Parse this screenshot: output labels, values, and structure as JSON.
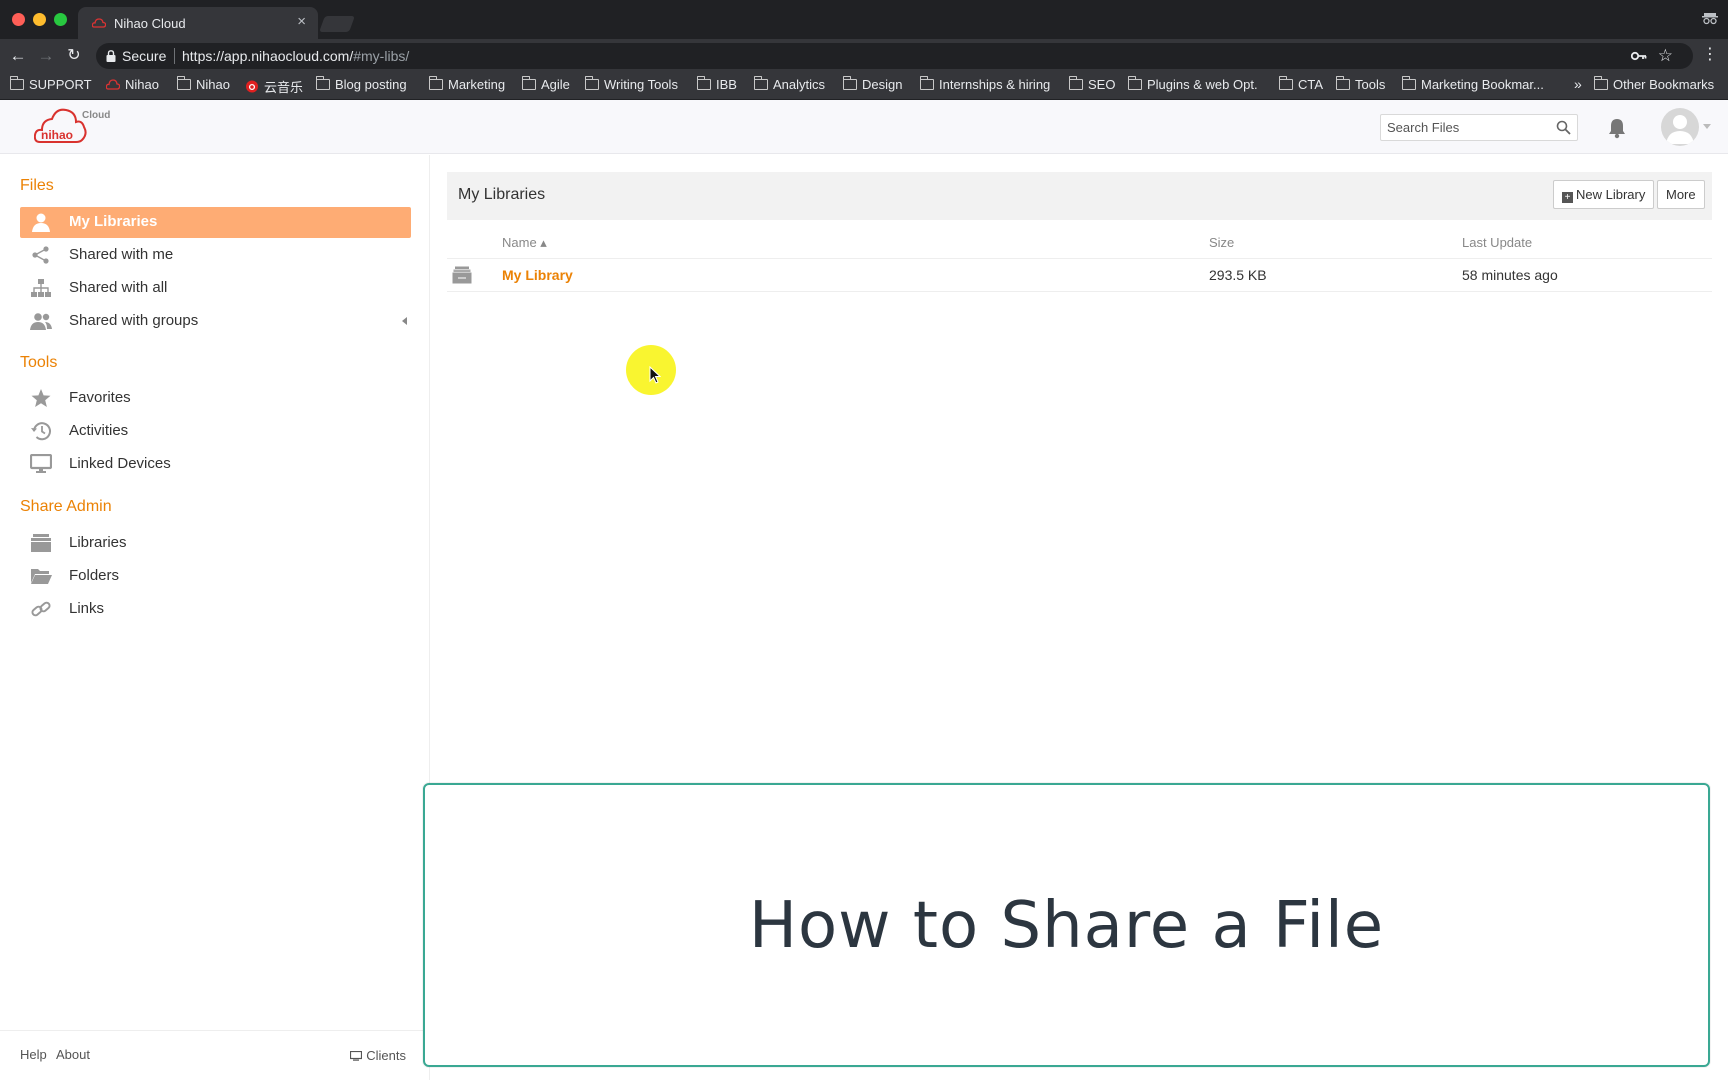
{
  "browser": {
    "tab_title": "Nihao Cloud",
    "tab_close": "×",
    "secure_label": "Secure",
    "url_base": "https://app.nihaocloud.com/",
    "url_hash": "#my-libs/",
    "bookmarks": [
      {
        "label": "SUPPORT",
        "icon": "folder-icon"
      },
      {
        "label": "Nihao",
        "icon": "nihao-favicon"
      },
      {
        "label": "Nihao",
        "icon": "folder-icon"
      },
      {
        "label": "云音乐",
        "icon": "netease-music-icon"
      },
      {
        "label": "Blog posting",
        "icon": "folder-icon"
      },
      {
        "label": "Marketing",
        "icon": "folder-icon"
      },
      {
        "label": "Agile",
        "icon": "folder-icon"
      },
      {
        "label": "Writing Tools",
        "icon": "folder-icon"
      },
      {
        "label": "IBB",
        "icon": "folder-icon"
      },
      {
        "label": "Analytics",
        "icon": "folder-icon"
      },
      {
        "label": "Design",
        "icon": "folder-icon"
      },
      {
        "label": "Internships & hiring",
        "icon": "folder-icon"
      },
      {
        "label": "SEO",
        "icon": "folder-icon"
      },
      {
        "label": "Plugins & web Opt.",
        "icon": "folder-icon"
      },
      {
        "label": "CTA",
        "icon": "folder-icon"
      },
      {
        "label": "Tools",
        "icon": "folder-icon"
      },
      {
        "label": "Marketing Bookmar...",
        "icon": "folder-icon"
      }
    ],
    "overflow": "»",
    "other_bookmarks": "Other Bookmarks"
  },
  "header": {
    "logo_text": "nihao",
    "logo_sub": "Cloud",
    "search_placeholder": "Search Files"
  },
  "sidebar": {
    "files_heading": "Files",
    "files_items": [
      {
        "label": "My Libraries",
        "icon": "user-icon",
        "active": true
      },
      {
        "label": "Shared with me",
        "icon": "share-nodes-icon"
      },
      {
        "label": "Shared with all",
        "icon": "org-chart-icon"
      },
      {
        "label": "Shared with groups",
        "icon": "group-icon"
      }
    ],
    "tools_heading": "Tools",
    "tools_items": [
      {
        "label": "Favorites",
        "icon": "star-icon"
      },
      {
        "label": "Activities",
        "icon": "history-icon"
      },
      {
        "label": "Linked Devices",
        "icon": "monitor-icon"
      }
    ],
    "admin_heading": "Share Admin",
    "admin_items": [
      {
        "label": "Libraries",
        "icon": "library-stack-icon"
      },
      {
        "label": "Folders",
        "icon": "folder-open-icon"
      },
      {
        "label": "Links",
        "icon": "link-icon"
      }
    ],
    "footer": {
      "help": "Help",
      "about": "About",
      "clients": "Clients"
    }
  },
  "main": {
    "title": "My Libraries",
    "new_library": "New Library",
    "more": "More",
    "columns": {
      "name": "Name ▴",
      "size": "Size",
      "updated": "Last Update"
    },
    "rows": [
      {
        "name": "My Library",
        "size": "293.5 KB",
        "updated": "58 minutes ago"
      }
    ]
  },
  "overlay": {
    "title": "How to Share a File"
  },
  "colors": {
    "accent": "#eb8205",
    "active_bg": "#feac74",
    "overlay_border": "#3aa893",
    "cursor_highlight": "#f9f41e"
  }
}
